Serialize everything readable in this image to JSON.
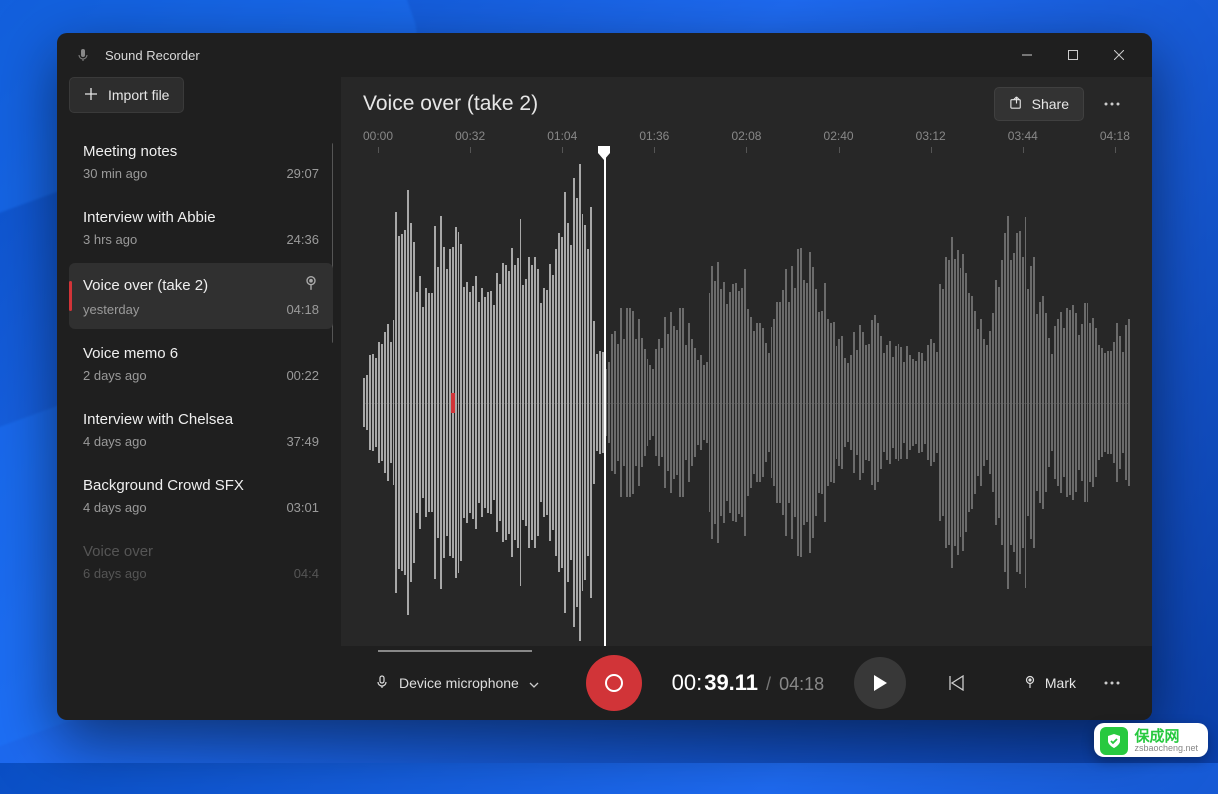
{
  "app": {
    "title": "Sound Recorder"
  },
  "sidebar": {
    "import_label": "Import file",
    "items": [
      {
        "title": "Meeting notes",
        "sub": "30 min ago",
        "dur": "29:07",
        "selected": false,
        "marker": false
      },
      {
        "title": "Interview with Abbie",
        "sub": "3 hrs ago",
        "dur": "24:36",
        "selected": false,
        "marker": false
      },
      {
        "title": "Voice over (take 2)",
        "sub": "yesterday",
        "dur": "04:18",
        "selected": true,
        "marker": true
      },
      {
        "title": "Voice memo 6",
        "sub": "2 days ago",
        "dur": "00:22",
        "selected": false,
        "marker": false
      },
      {
        "title": "Interview with Chelsea",
        "sub": "4 days ago",
        "dur": "37:49",
        "selected": false,
        "marker": false
      },
      {
        "title": "Background Crowd SFX",
        "sub": "4 days ago",
        "dur": "03:01",
        "selected": false,
        "marker": false
      },
      {
        "title": "Voice over",
        "sub": "6 days ago",
        "dur": "04:4",
        "selected": false,
        "marker": false,
        "faded": true
      }
    ]
  },
  "main": {
    "title": "Voice over (take 2)",
    "share_label": "Share",
    "ruler": [
      "00:00",
      "00:32",
      "01:04",
      "01:36",
      "02:08",
      "02:40",
      "03:12",
      "03:44",
      "04:18"
    ]
  },
  "footer": {
    "device_label": "Device microphone",
    "time_prefix": "00:",
    "time_current": "39.11",
    "time_total": "04:18",
    "mark_label": "Mark"
  },
  "watermark": {
    "line1": "保成网",
    "line2": "zsbaocheng.net"
  }
}
